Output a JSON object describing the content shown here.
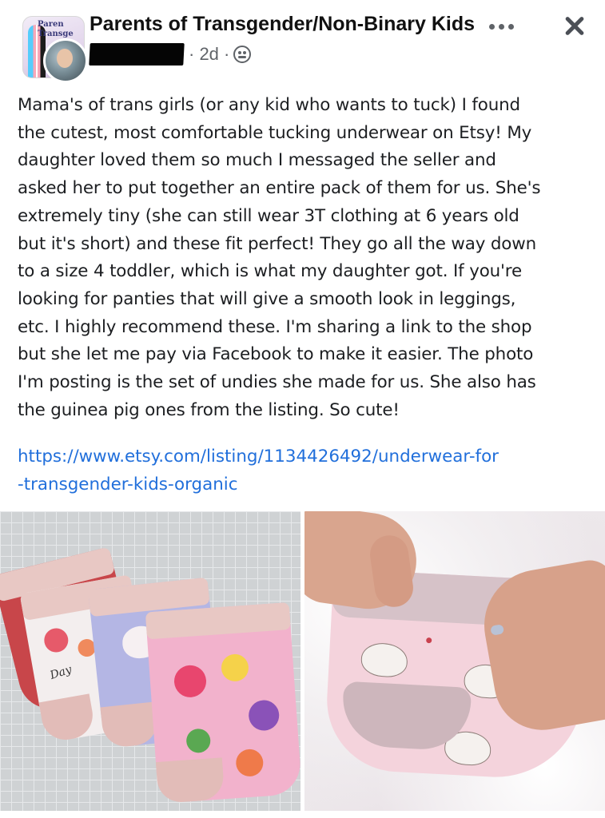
{
  "post": {
    "group_name": "Parents of Transgender/Non-Binary Kids",
    "group_avatar_text": "Paren\nTransge",
    "time": "· 2d ·",
    "privacy_icon": "globe-icon",
    "body": "Mama's of trans girls (or any kid who wants to tuck) I found\nthe cutest, most comfortable tucking underwear on Etsy! My\ndaughter loved them so much I messaged the seller and\nasked her to put together an entire pack of them for us. She's\nextremely tiny (she can still wear 3T clothing at 6 years old\nbut it's short) and these fit perfect! They go all the way down\nto a size 4 toddler, which is what my daughter got. If you're\nlooking for panties that will give a smooth look in leggings,\netc. I highly recommend these. I'm sharing a link to the shop\nbut she let me pay via Facebook to make it easier. The photo\nI'm posting is the set of undies she made for us. She also has\nthe guinea pig ones from the listing. So cute!",
    "link": "https://www.etsy.com/listing/1134426492/underwear-for\n-transgender-kids-organic",
    "photo_left_script_text": "Day"
  },
  "icons": {
    "more": "more-options-icon",
    "close": "close-icon"
  },
  "colors": {
    "link": "#216fdb",
    "meta": "#5f6368"
  }
}
